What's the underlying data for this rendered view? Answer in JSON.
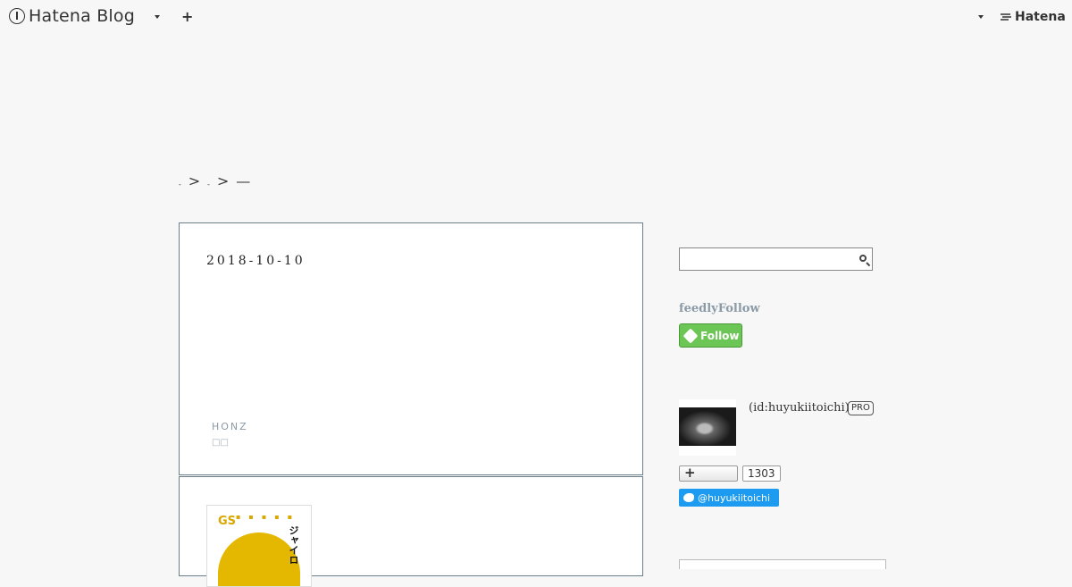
{
  "navbar": {
    "brand": "Hatena Blog",
    "add_icon": "+",
    "hatena_label": "Hatena",
    "icons": [
      "hatena-blog-logo-icon",
      "chevron-down-icon",
      "plus-icon",
      "hatena-logo-icon"
    ]
  },
  "breadcrumb": {
    "items": [
      "-",
      ">",
      "-",
      ">",
      "—"
    ]
  },
  "entry": {
    "date": "2018-10-10",
    "source": "HONZ",
    "source_sub": "□□"
  },
  "book": {
    "series_mark": "GS",
    "title_vertical": "ジャイロ"
  },
  "sidebar": {
    "search": {
      "placeholder": "",
      "value": ""
    },
    "feedly": {
      "heading": "feedlyFollow",
      "button_label": "Follow"
    },
    "profile": {
      "id_text": "(id:huyukiitoichi)",
      "badge": "PRO"
    },
    "reader": {
      "count": "1303"
    },
    "twitter": {
      "label": "@huyukiitoichi"
    }
  },
  "colors": {
    "background": "#f7f7f7",
    "feedly_green": "#6cc655",
    "twitter_blue": "#1d9bf0",
    "entry_border": "#6a7f8a"
  }
}
